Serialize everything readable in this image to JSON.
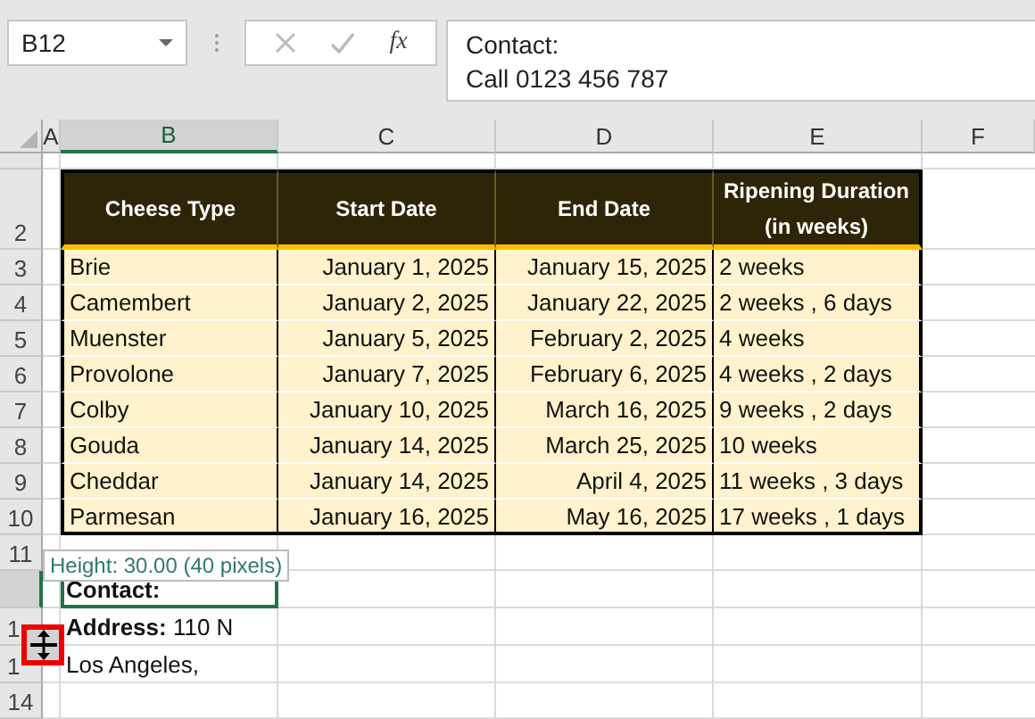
{
  "name_box": "B12",
  "function_label": "fx",
  "formula_lines": [
    "Contact:",
    "Call 0123 456 787"
  ],
  "columns": [
    {
      "label": "A",
      "selected": false
    },
    {
      "label": "B",
      "selected": true
    },
    {
      "label": "C",
      "selected": false
    },
    {
      "label": "D",
      "selected": false
    },
    {
      "label": "E",
      "selected": false
    },
    {
      "label": "F",
      "selected": false
    }
  ],
  "rows": [
    {
      "kind": "gap",
      "selected": false
    },
    {
      "kind": "table-head",
      "header": "2",
      "selected": false,
      "cells": [
        "Cheese Type",
        "Start Date",
        "End Date",
        "Ripening Duration (in weeks)"
      ]
    },
    {
      "kind": "table-row",
      "header": "3",
      "selected": false,
      "cells": [
        "Brie",
        "January 1, 2025",
        "January 15, 2025",
        "2 weeks"
      ]
    },
    {
      "kind": "table-row",
      "header": "4",
      "selected": false,
      "cells": [
        "Camembert",
        "January 2, 2025",
        "January 22, 2025",
        "2 weeks , 6 days"
      ]
    },
    {
      "kind": "table-row",
      "header": "5",
      "selected": false,
      "cells": [
        "Muenster",
        "January 5, 2025",
        "February 2, 2025",
        "4 weeks"
      ]
    },
    {
      "kind": "table-row",
      "header": "6",
      "selected": false,
      "cells": [
        "Provolone",
        "January 7, 2025",
        "February 6, 2025",
        "4 weeks , 2 days"
      ]
    },
    {
      "kind": "table-row",
      "header": "7",
      "selected": false,
      "cells": [
        "Colby",
        "January 10, 2025",
        "March 16, 2025",
        "9 weeks , 2 days"
      ]
    },
    {
      "kind": "table-row",
      "header": "8",
      "selected": false,
      "cells": [
        "Gouda",
        "January 14, 2025",
        "March 25, 2025",
        "10 weeks"
      ]
    },
    {
      "kind": "table-row",
      "header": "9",
      "selected": false,
      "cells": [
        "Cheddar",
        "January 14, 2025",
        "April 4, 2025",
        "11 weeks , 3 days"
      ]
    },
    {
      "kind": "table-row",
      "header": "10",
      "selected": false,
      "cells": [
        "Parmesan",
        "January 16, 2025",
        "May 16, 2025",
        "17 weeks , 1 days"
      ]
    },
    {
      "kind": "blank",
      "header": "11",
      "selected": false
    },
    {
      "kind": "note",
      "selected": true,
      "cells": [
        "**Contact:**"
      ]
    },
    {
      "kind": "note",
      "header": "1",
      "selected": false,
      "cells": [
        "**Address:** 110 N"
      ]
    },
    {
      "kind": "note",
      "header": "1",
      "selected": false,
      "cells": [
        "Los Angeles,"
      ]
    },
    {
      "kind": "blank",
      "header": "14",
      "selected": false
    }
  ],
  "tooltip": "Height: 30.00 (40 pixels)"
}
